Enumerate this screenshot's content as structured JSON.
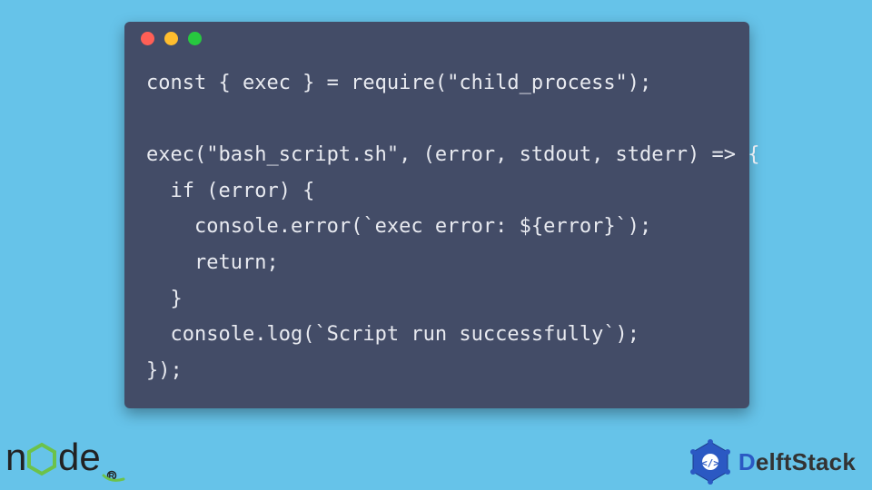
{
  "window": {
    "traffic_lights": {
      "red": "close",
      "yellow": "minimize",
      "green": "zoom"
    }
  },
  "code": {
    "lines": [
      "const { exec } = require(\"child_process\");",
      "",
      "exec(\"bash_script.sh\", (error, stdout, stderr) => {",
      "  if (error) {",
      "    console.error(`exec error: ${error}`);",
      "    return;",
      "  }",
      "  console.log(`Script run successfully`);",
      "});"
    ]
  },
  "footer": {
    "node_label": "node",
    "delft_brand_initial": "D",
    "delft_brand_rest": "elftStack"
  },
  "colors": {
    "page_bg": "#66c3e9",
    "window_bg": "#434c67",
    "code_fg": "#e8eaf0",
    "delft_blue": "#2b59c3"
  }
}
